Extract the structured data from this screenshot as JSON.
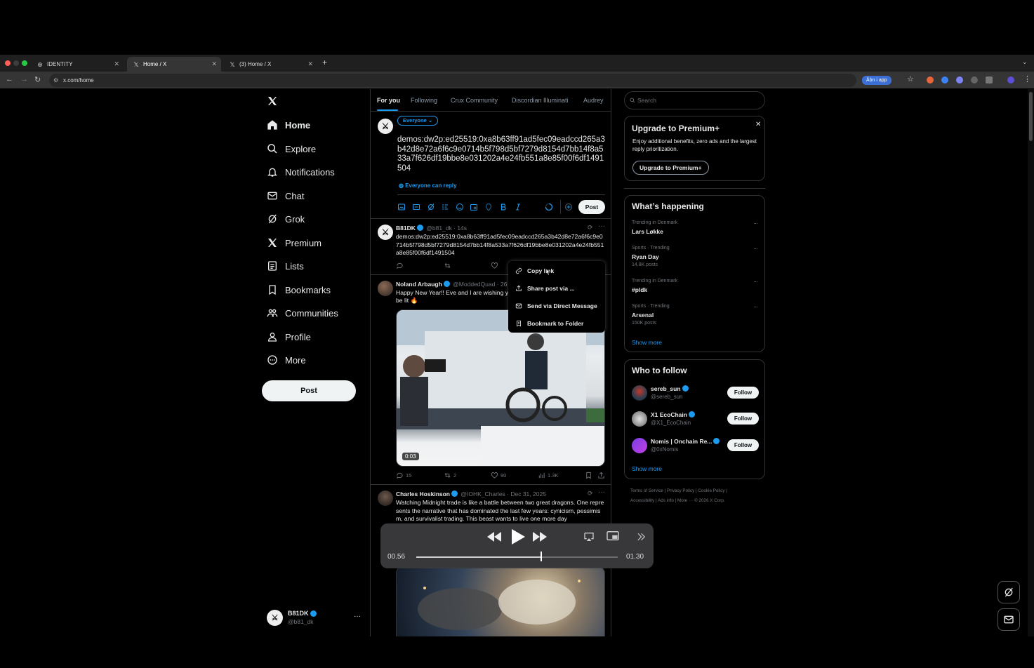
{
  "browser": {
    "tabs": [
      {
        "title": "IDENTITY",
        "active": false
      },
      {
        "title": "Home / X",
        "active": true
      },
      {
        "title": "(3) Home / X",
        "active": false
      }
    ],
    "url": "x.com/home",
    "open_in_app": "Åbn i app"
  },
  "nav": {
    "items": [
      {
        "label": "Home",
        "icon": "home-icon"
      },
      {
        "label": "Explore",
        "icon": "search-icon"
      },
      {
        "label": "Notifications",
        "icon": "bell-icon"
      },
      {
        "label": "Chat",
        "icon": "mail-icon"
      },
      {
        "label": "Grok",
        "icon": "grok-icon"
      },
      {
        "label": "Premium",
        "icon": "x-icon"
      },
      {
        "label": "Lists",
        "icon": "list-icon"
      },
      {
        "label": "Bookmarks",
        "icon": "bookmark-icon"
      },
      {
        "label": "Communities",
        "icon": "people-icon"
      },
      {
        "label": "Profile",
        "icon": "person-icon"
      },
      {
        "label": "More",
        "icon": "more-circle-icon"
      }
    ],
    "post_label": "Post",
    "account": {
      "name": "B81DK",
      "handle": "@b81_dk",
      "more": "···"
    }
  },
  "feed": {
    "tabs": [
      "For you",
      "Following",
      "Crux Community",
      "Discordian Illuminati",
      "Audrey"
    ],
    "compose": {
      "audience": "Everyone",
      "text": "demos:dw2p:ed25519:0xa8b63ff91ad5fec09eadccd265a3b42d8e72a6f6c9e0714b5f798d5bf7279d8154d7bb14f8a533a7f626df19bbe8e031202a4e24fb551a8e85f00f6df1491504",
      "reply_note": "Everyone can reply",
      "post_label": "Post"
    },
    "posts": [
      {
        "name": "B81DK",
        "handle": "@b81_dk · 14s",
        "text": "demos:dw2p:ed25519:0xa8b63ff91ad5fec09eadccd265a3b42d8e72a6f6c9e0714b5f798d5bf7279d8154d7bb14f8a533a7f626df19bbe8e031202a4e24fb551a8e85f00f6df1491504"
      },
      {
        "name": "Noland Arbaugh",
        "handle": "@ModdedQuad · 26",
        "text": "Happy New Year!! Eve and I are wishing y",
        "text2": "be lit 🔥",
        "video_time": "0:03",
        "replies": "15",
        "reposts": "2",
        "likes": "90",
        "views": "1.3K"
      },
      {
        "name": "Charles Hoskinson",
        "handle": "@IOHK_Charles · Dec 31, 2025",
        "text": "Watching Midnight trade is like a battle between two great dragons. One represents the narrative that has dominated the last few years: cynicism, pessimism, and survivalist trading. This beast wants to live one more day"
      }
    ]
  },
  "context_menu": {
    "items": [
      "Copy link",
      "Share post via ...",
      "Send via Direct Message",
      "Bookmark to Folder"
    ]
  },
  "video_player": {
    "elapsed": "00.56",
    "total": "01.30",
    "progress": 0.62
  },
  "sidebar": {
    "search_placeholder": "Search",
    "premium": {
      "title": "Upgrade to Premium+",
      "body": "Enjoy additional benefits, zero ads and the largest reply prioritization.",
      "button": "Upgrade to Premium+"
    },
    "happening": {
      "title": "What’s happening",
      "trends": [
        {
          "meta": "Trending in Denmark",
          "name": "Lars Løkke",
          "posts": ""
        },
        {
          "meta": "Sports · Trending",
          "name": "Ryan Day",
          "posts": "14.8K posts"
        },
        {
          "meta": "Trending in Denmark",
          "name": "#pldk",
          "posts": ""
        },
        {
          "meta": "Sports · Trending",
          "name": "Arsenal",
          "posts": "150K posts"
        }
      ],
      "show_more": "Show more"
    },
    "who_to_follow": {
      "title": "Who to follow",
      "accounts": [
        {
          "name": "sereb_sun",
          "handle": "@sereb_sun",
          "button": "Follow"
        },
        {
          "name": "X1 EcoChain",
          "handle": "@X1_EcoChain",
          "button": "Follow"
        },
        {
          "name": "Nomis | Onchain Re...",
          "handle": "@0xNomis",
          "button": "Follow"
        }
      ],
      "show_more": "Show more"
    },
    "footer_line1": "Terms of Service  |  Privacy Policy  |  Cookie Policy  |",
    "footer_line2": "Accessibility  |  Ads info  |  More ···  © 2026 X Corp."
  },
  "colors": {
    "accent": "#1d9bf0",
    "background": "#000000",
    "border": "#2f3336",
    "muted_text": "#71767b"
  }
}
